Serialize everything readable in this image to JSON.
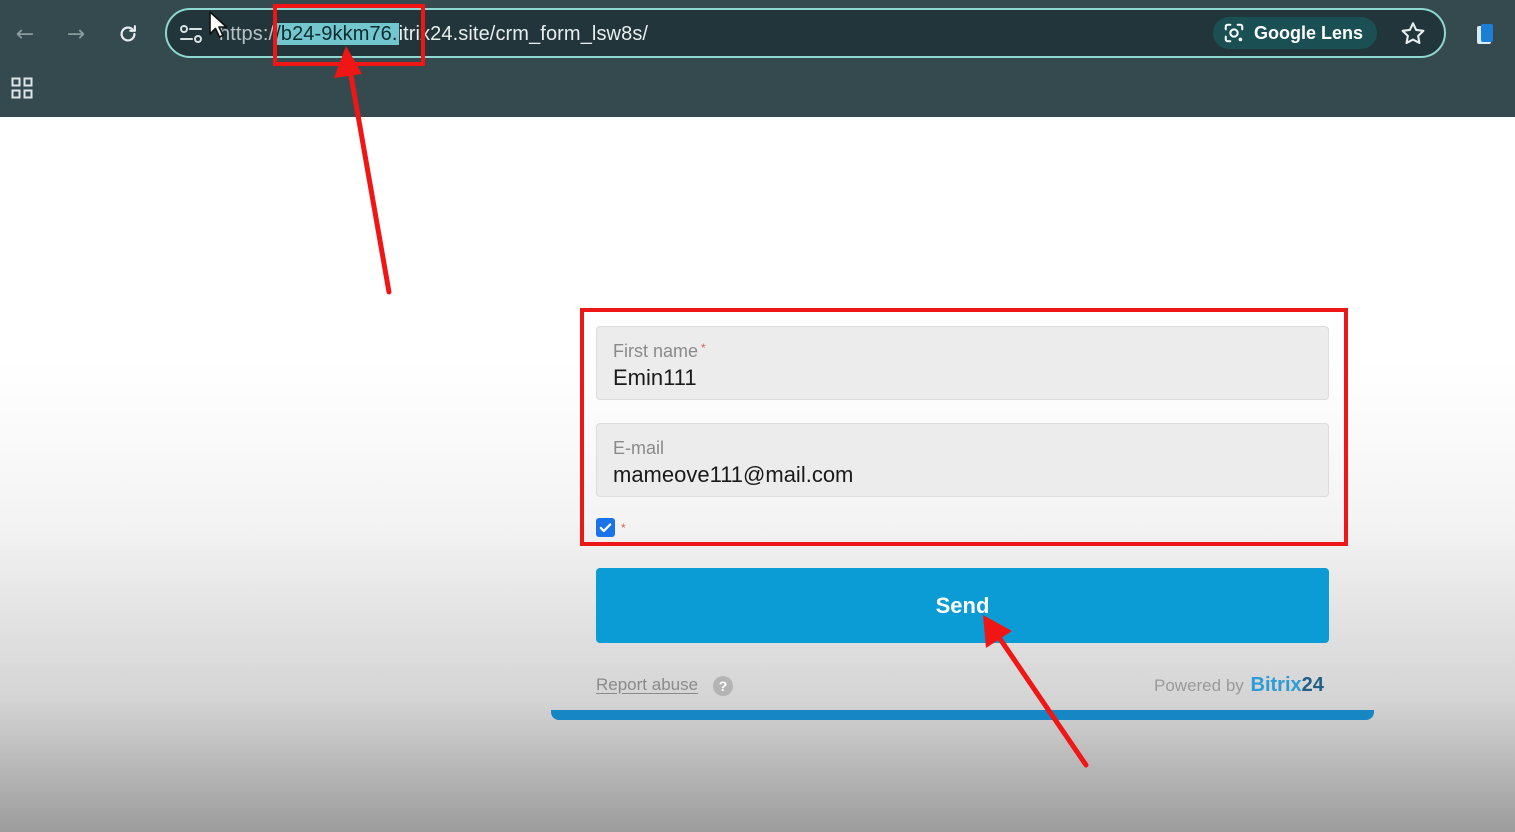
{
  "browser": {
    "url_scheme": "https:/",
    "url_selected": "/b24-9kkm76.",
    "url_rest": "itrix24.site/crm_form_lsw8s/",
    "lens_label": "Google Lens",
    "icons": [
      "back-arrow-icon",
      "forward-arrow-icon",
      "reload-icon",
      "site-info-icon",
      "google-lens-icon",
      "bookmark-star-icon",
      "extension-icon",
      "apps-grid-icon",
      "mouse-cursor-icon"
    ]
  },
  "form": {
    "fields": [
      {
        "label": "First name",
        "required_mark": "*",
        "value": "Emin111"
      },
      {
        "label": "E-mail",
        "value": "mameove111@mail.com"
      }
    ],
    "consent_required_mark": "*",
    "send_label": "Send",
    "report_abuse": "Report abuse",
    "help_glyph": "?",
    "powered_by": "Powered by",
    "brand_name": "Bitrix",
    "brand_number": "24"
  },
  "colors": {
    "chrome_bg": "#354a4f",
    "highlight_red": "#f01616",
    "send_button": "#0b9bd5",
    "brand_blue": "#2d9bd6"
  }
}
